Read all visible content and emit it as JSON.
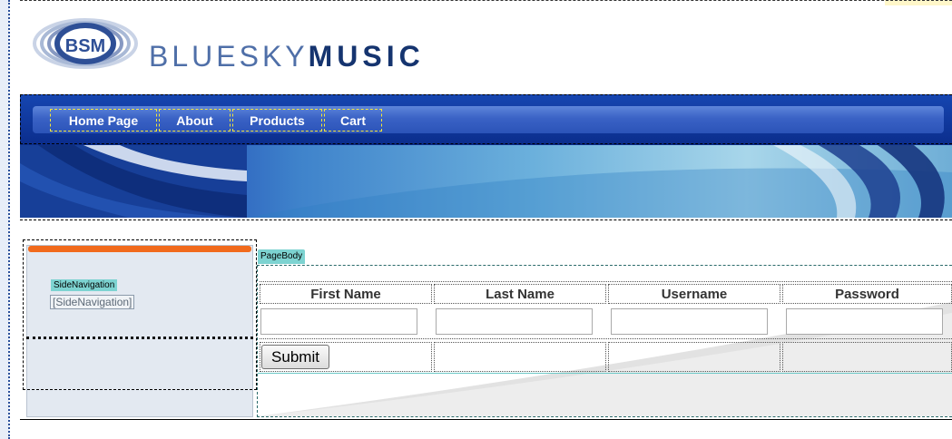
{
  "brand": {
    "logo_text": "BSM",
    "name_light": "BLUESKY",
    "name_bold": "MUSIC"
  },
  "nav": {
    "items": [
      {
        "label": "Home Page"
      },
      {
        "label": "About"
      },
      {
        "label": "Products"
      },
      {
        "label": "Cart"
      }
    ]
  },
  "side_navigation": {
    "tag": "SideNavigation",
    "placeholder": "[SideNavigation]"
  },
  "page_body": {
    "tag": "PageBody",
    "columns": [
      "First Name",
      "Last Name",
      "Username",
      "Password"
    ],
    "inputs": [
      {
        "value": ""
      },
      {
        "value": ""
      },
      {
        "value": ""
      },
      {
        "value": ""
      }
    ],
    "submit_label": "Submit"
  },
  "colors": {
    "nav_blue": "#1646b1",
    "accent_orange": "#f16a1c",
    "tag_teal": "#7dd3d1",
    "guide_yellow": "#f5e63a"
  }
}
